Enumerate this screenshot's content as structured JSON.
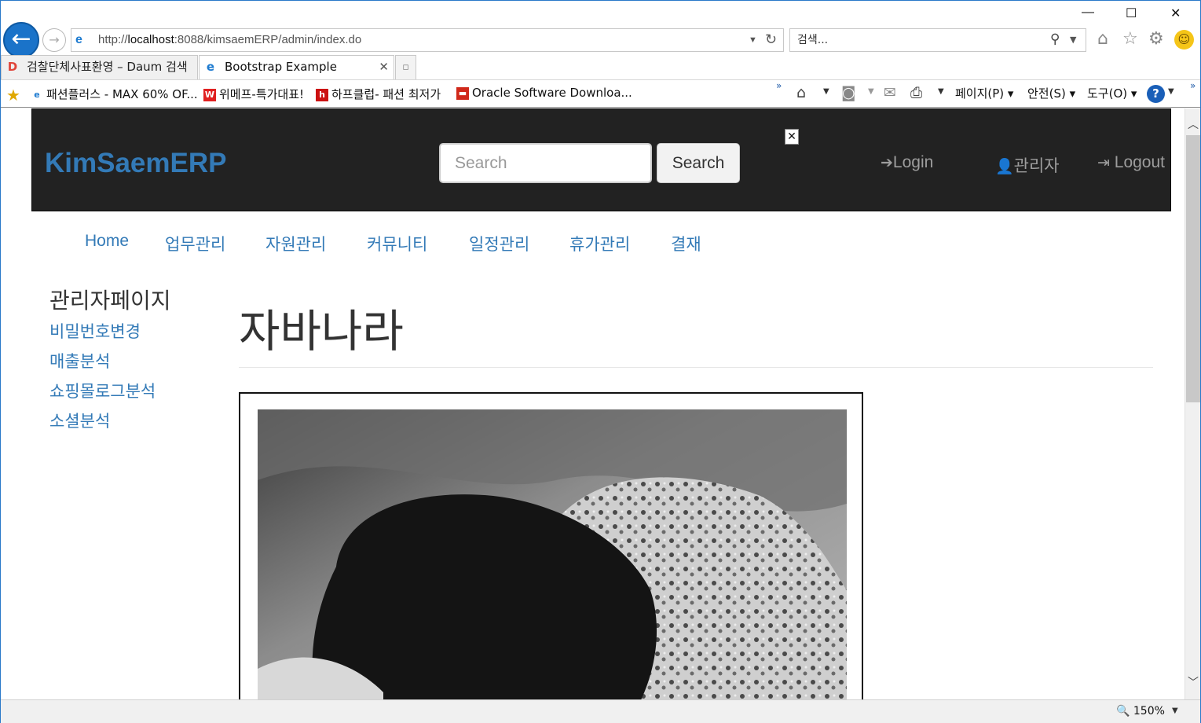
{
  "browser": {
    "url_prefix": "http://",
    "url_host": "localhost",
    "url_rest": ":8088/kimsaemERP/admin/index.do",
    "search_placeholder": "검색...",
    "tabs": [
      {
        "label": "검찰단체사표환영 – Daum 검색",
        "active": false
      },
      {
        "label": "Bootstrap Example",
        "active": true
      }
    ],
    "favorites": [
      {
        "label": "패션플러스 - MAX 60% OF...",
        "icon": "ie-page-icon",
        "icon_char": "e",
        "color": "#1e7bd0"
      },
      {
        "label": "위메프-특가대표!",
        "icon": "wemakeprice-icon",
        "icon_char": "W",
        "color": "#e02020"
      },
      {
        "label": "하프클럽- 패션 최저가",
        "icon": "halfclub-icon",
        "icon_char": "h",
        "color": "#cc1111"
      },
      {
        "label": "Oracle Software Downloa...",
        "icon": "oracle-icon",
        "icon_char": "▬",
        "color": "#d0281a"
      }
    ],
    "commands": {
      "page": "페이지(P)",
      "safety": "안전(S)",
      "tools": "도구(O)"
    },
    "zoom": "150%"
  },
  "site": {
    "brand": "KimSaemERP",
    "search_placeholder": "Search",
    "search_button": "Search",
    "nav_right": [
      {
        "label": "Login",
        "icon": "log-in-icon",
        "glyph": "➔"
      },
      {
        "label": "관리자",
        "icon": "user-icon",
        "glyph": "👤"
      },
      {
        "label": "Logout",
        "icon": "log-out-icon",
        "glyph": "⇥"
      }
    ],
    "menu": [
      "Home",
      "업무관리",
      "자원관리",
      "커뮤니티",
      "일정관리",
      "휴가관리",
      "결재"
    ],
    "sidebar": {
      "title": "관리자페이지",
      "links": [
        "비밀번호변경",
        "매출분석",
        "쇼핑몰로그분석",
        "소셜분석"
      ]
    },
    "page_title": "자바나라"
  },
  "colors": {
    "navbar_bg": "#222222",
    "link": "#337ab7",
    "navbar_text": "#9d9d9d"
  }
}
